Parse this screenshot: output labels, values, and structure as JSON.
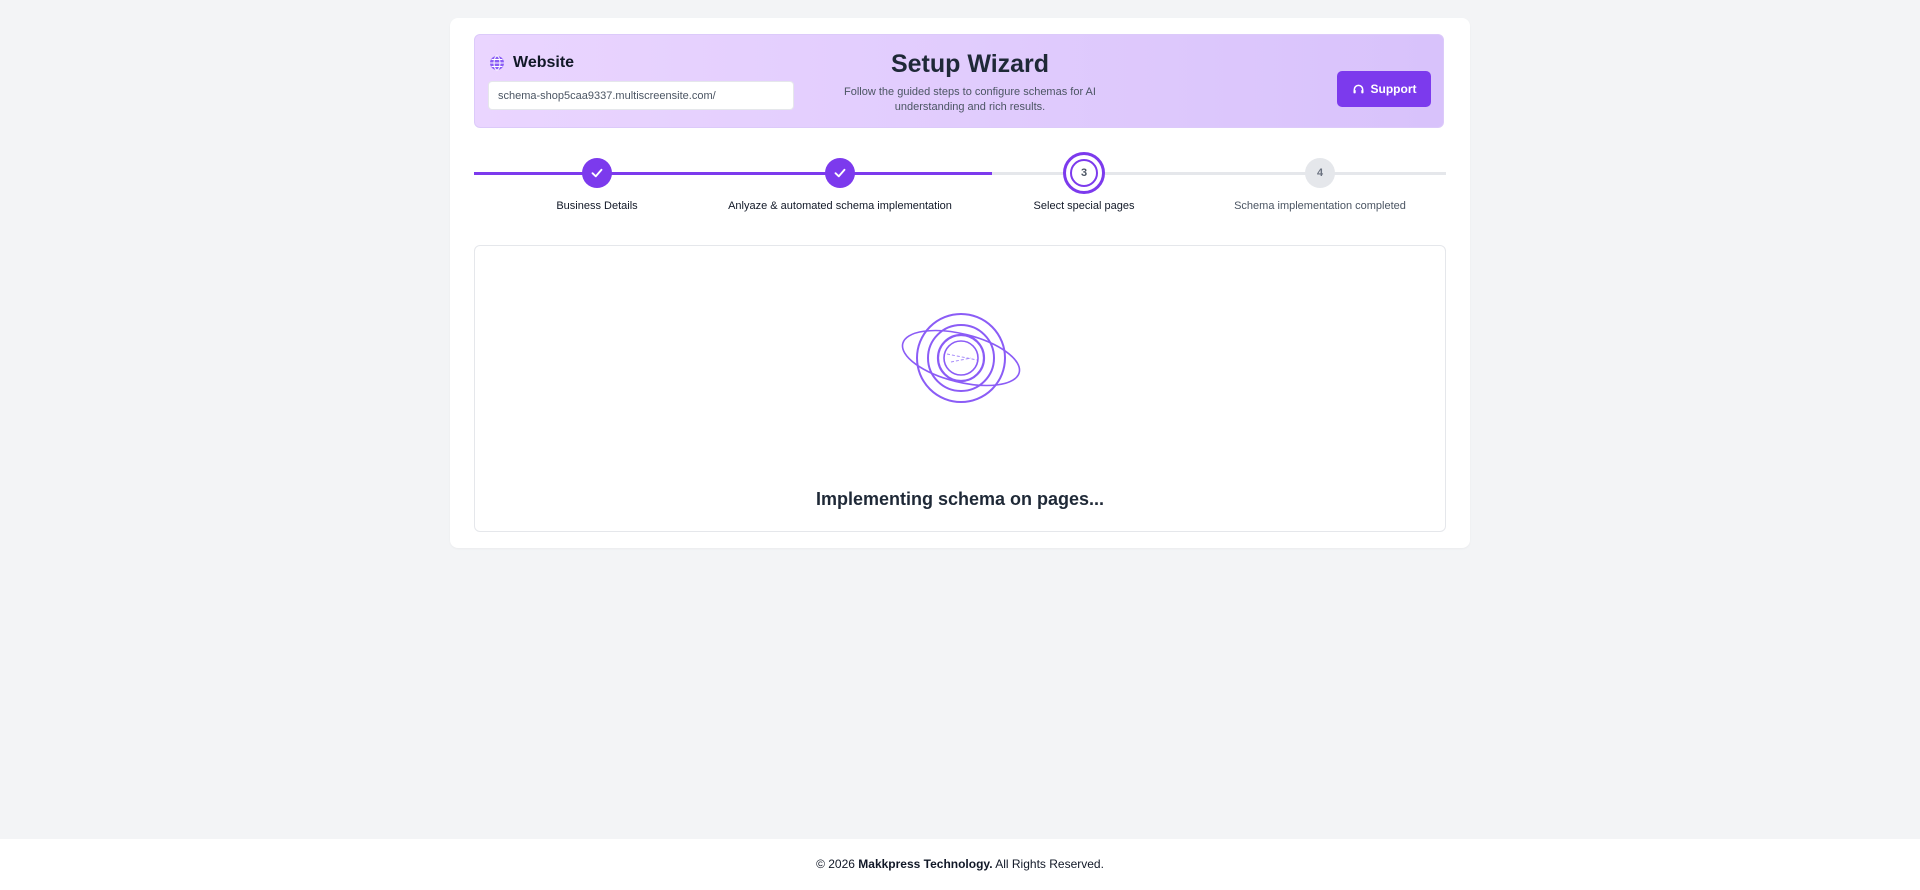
{
  "header": {
    "website_label": "Website",
    "website_url": "schema-shop5caa9337.multiscreensite.com/",
    "title": "Setup Wizard",
    "subtitle": "Follow the guided steps to configure schemas for AI understanding and rich results.",
    "support_label": "Support"
  },
  "stepper": {
    "steps": [
      {
        "number": "1",
        "label": "Business Details",
        "status": "completed"
      },
      {
        "number": "2",
        "label": "Anlyaze & automated schema implementation",
        "status": "completed"
      },
      {
        "number": "3",
        "label": "Select special pages",
        "status": "current"
      },
      {
        "number": "4",
        "label": "Schema implementation completed",
        "status": "pending"
      }
    ]
  },
  "main": {
    "status_text": "Implementing schema on pages..."
  },
  "footer": {
    "prefix": "© 2026",
    "company": "Makkpress Technology.",
    "suffix": "All Rights Reserved."
  },
  "colors": {
    "accent": "#7c3aed",
    "header_bg": "#e4cffd",
    "page_bg": "#f3f4f6"
  },
  "icons": {
    "website": "globe-icon",
    "support": "headset-icon",
    "completed_step": "check-icon",
    "loader": "orbit-loader-icon"
  }
}
